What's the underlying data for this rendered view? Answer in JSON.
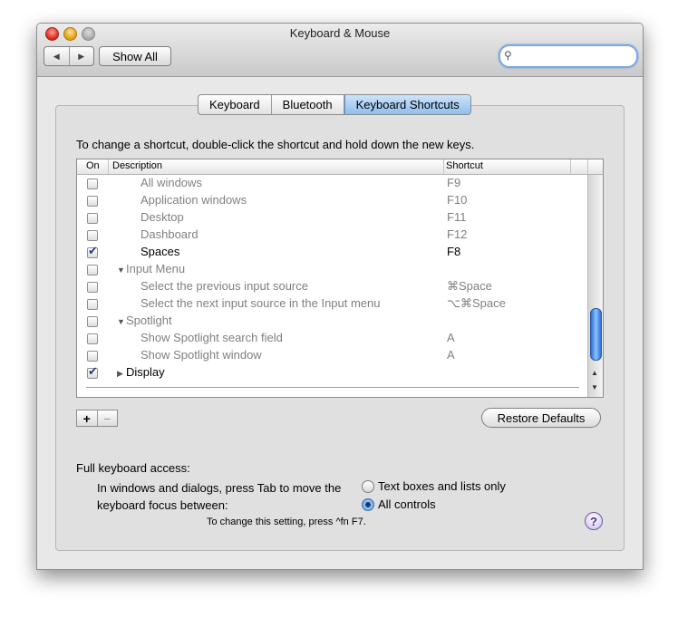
{
  "window": {
    "title": "Keyboard & Mouse"
  },
  "toolbar": {
    "back_icon": "◀",
    "forward_icon": "▶",
    "show_all": "Show All",
    "search_icon": "⚲",
    "search_placeholder": ""
  },
  "tabs": [
    {
      "label": "Keyboard",
      "active": false
    },
    {
      "label": "Bluetooth",
      "active": false
    },
    {
      "label": "Keyboard Shortcuts",
      "active": true
    }
  ],
  "instruction": "To change a shortcut, double-click the shortcut and hold down the new keys.",
  "table": {
    "columns": {
      "on": "On",
      "description": "Description",
      "shortcut": "Shortcut"
    },
    "rows": [
      {
        "checked": false,
        "description": "All windows",
        "shortcut": "F9",
        "indent": 2,
        "dim": true
      },
      {
        "checked": false,
        "description": "Application windows",
        "shortcut": "F10",
        "indent": 2,
        "dim": true
      },
      {
        "checked": false,
        "description": "Desktop",
        "shortcut": "F11",
        "indent": 2,
        "dim": true
      },
      {
        "checked": false,
        "description": "Dashboard",
        "shortcut": "F12",
        "indent": 2,
        "dim": true
      },
      {
        "checked": true,
        "description": "Spaces",
        "shortcut": "F8",
        "indent": 2,
        "dim": false
      },
      {
        "checked": false,
        "description": "Input Menu",
        "shortcut": "",
        "indent": 1,
        "dim": true,
        "disclosure": "▼"
      },
      {
        "checked": false,
        "description": "Select the previous input source",
        "shortcut": "⌘Space",
        "indent": 2,
        "dim": true
      },
      {
        "checked": false,
        "description": "Select the next input source in the Input menu",
        "shortcut": "⌥⌘Space",
        "indent": 2,
        "dim": true
      },
      {
        "checked": false,
        "description": "Spotlight",
        "shortcut": "",
        "indent": 1,
        "dim": true,
        "disclosure": "▼"
      },
      {
        "checked": false,
        "description": "Show Spotlight search field",
        "shortcut": "A",
        "indent": 2,
        "dim": true
      },
      {
        "checked": false,
        "description": "Show Spotlight window",
        "shortcut": "A",
        "indent": 2,
        "dim": true
      },
      {
        "checked": true,
        "description": "Display",
        "shortcut": "",
        "indent": 1,
        "dim": false,
        "disclosure": "▶"
      }
    ]
  },
  "buttons": {
    "add": "+",
    "remove": "−",
    "restore_defaults": "Restore Defaults"
  },
  "keyboard_access": {
    "heading": "Full keyboard access:",
    "description": "In windows and dialogs, press Tab to move the keyboard focus between:",
    "options": [
      {
        "label": "Text boxes and lists only",
        "selected": false
      },
      {
        "label": "All controls",
        "selected": true
      }
    ],
    "note": "To change this setting, press ^fn F7.",
    "help_icon": "?"
  }
}
